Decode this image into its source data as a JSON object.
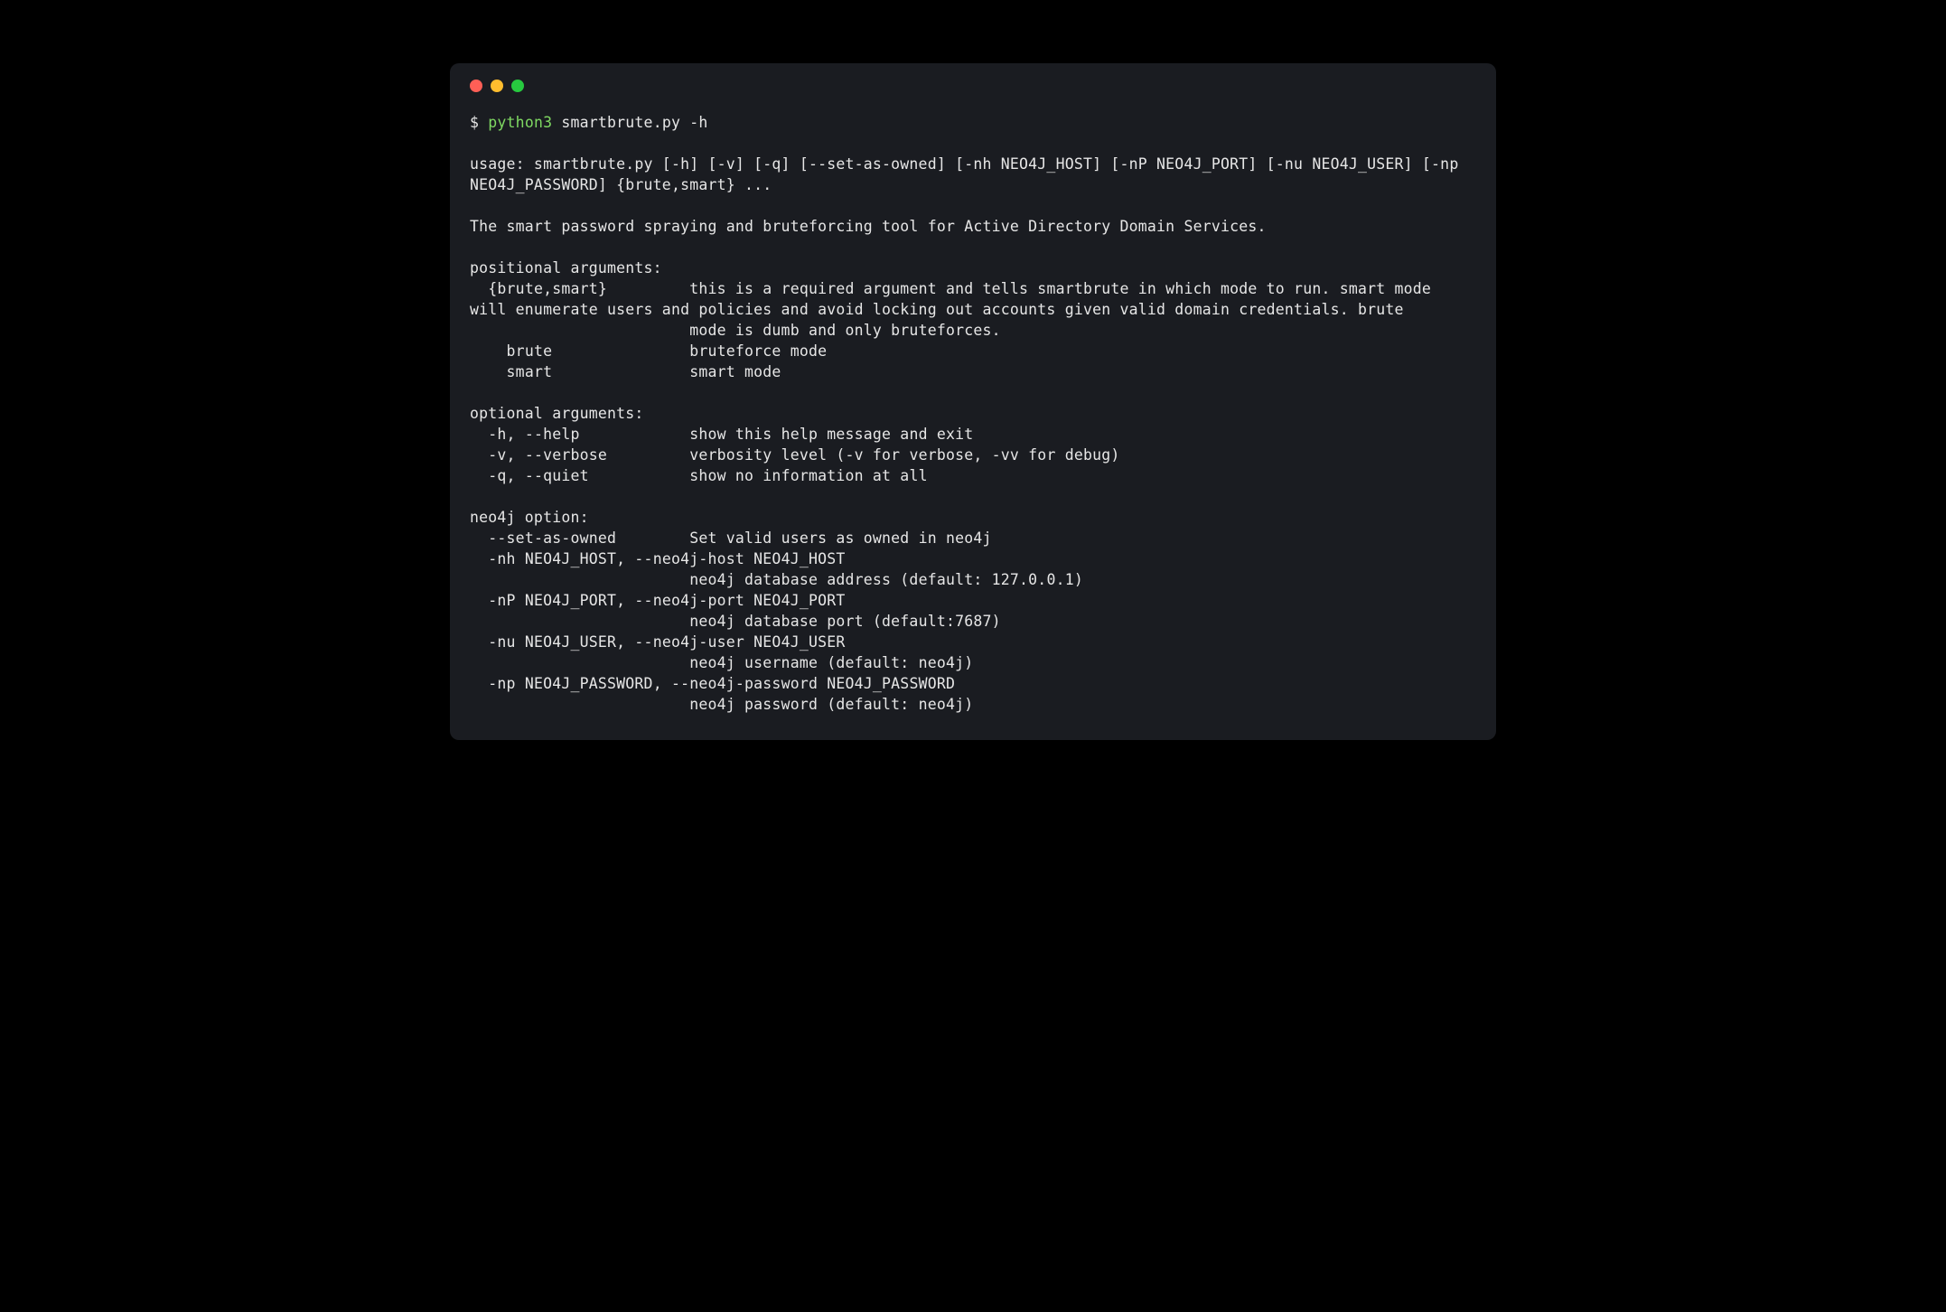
{
  "window": {
    "traffic_lights": {
      "red": "#ff5f56",
      "yellow": "#ffbd2e",
      "green": "#27c93f"
    }
  },
  "prompt": {
    "symbol": "$ ",
    "command_highlight": "python3",
    "command_rest": " smartbrute.py -h"
  },
  "output": {
    "usage": "usage: smartbrute.py [-h] [-v] [-q] [--set-as-owned] [-nh NEO4J_HOST] [-nP NEO4J_PORT] [-nu NEO4J_USER] [-np NEO4J_PASSWORD] {brute,smart} ...",
    "description": "The smart password spraying and bruteforcing tool for Active Directory Domain Services.",
    "positional_header": "positional arguments:",
    "positional_block": "  {brute,smart}         this is a required argument and tells smartbrute in which mode to run. smart mode will enumerate users and policies and avoid locking out accounts given valid domain credentials. brute\n                        mode is dumb and only bruteforces.\n    brute               bruteforce mode\n    smart               smart mode",
    "optional_header": "optional arguments:",
    "optional_block": "  -h, --help            show this help message and exit\n  -v, --verbose         verbosity level (-v for verbose, -vv for debug)\n  -q, --quiet           show no information at all",
    "neo4j_header": "neo4j option:",
    "neo4j_block": "  --set-as-owned        Set valid users as owned in neo4j\n  -nh NEO4J_HOST, --neo4j-host NEO4J_HOST\n                        neo4j database address (default: 127.0.0.1)\n  -nP NEO4J_PORT, --neo4j-port NEO4J_PORT\n                        neo4j database port (default:7687)\n  -nu NEO4J_USER, --neo4j-user NEO4J_USER\n                        neo4j username (default: neo4j)\n  -np NEO4J_PASSWORD, --neo4j-password NEO4J_PASSWORD\n                        neo4j password (default: neo4j)"
  }
}
